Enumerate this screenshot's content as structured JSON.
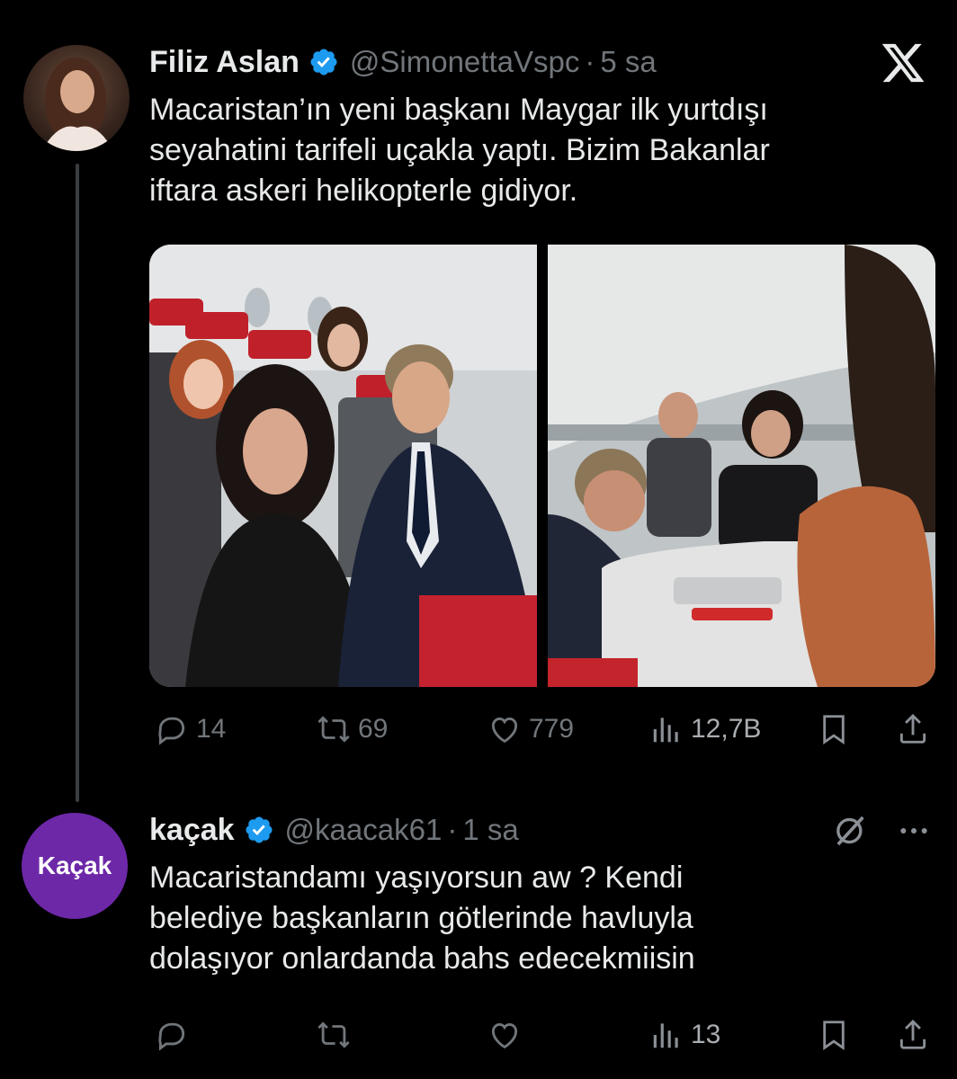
{
  "tweet1": {
    "name": "Filiz Aslan",
    "handle": "@SimonettaVspc",
    "separator": "·",
    "time": "5 sa",
    "text_lines": [
      "Macaristan’ın yeni başkanı Maygar ilk yurtdışı",
      "seyahatini tarifeli uçakla yaptı. Bizim Bakanlar",
      "iftara askeri helikopterle gidiyor."
    ],
    "stats": {
      "replies": "14",
      "reposts": "69",
      "likes": "779",
      "views": "12,7B"
    }
  },
  "tweet2": {
    "name": "kaçak",
    "handle": "@kaacak61",
    "separator": "·",
    "time": "1 sa",
    "avatar_text": "Kaçak",
    "text_lines": [
      "Macaristandamı yaşıyorsun aw ? Kendi",
      "belediye başkanların götlerinde havluyla",
      "dolaşıyor onlardanda bahs edecekmiisin"
    ],
    "stats": {
      "views": "13"
    }
  },
  "colors": {
    "background": "#000000",
    "text": "#e7e9ea",
    "muted": "#71767b",
    "verified": "#1d9bf0",
    "avatar_purple": "#6d28a8"
  },
  "icons": [
    "x-logo-icon",
    "verified-badge-icon",
    "reply-icon",
    "repost-icon",
    "like-icon",
    "views-icon",
    "bookmark-icon",
    "share-icon",
    "grok-icon",
    "more-icon"
  ]
}
